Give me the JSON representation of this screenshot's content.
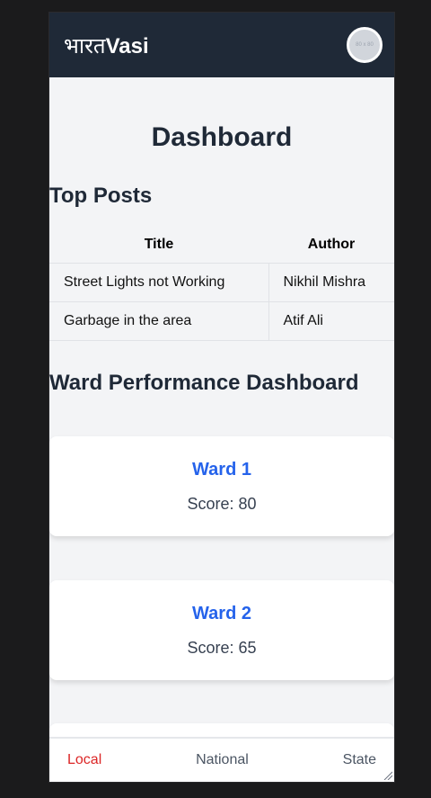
{
  "header": {
    "brand_prefix": "भारत",
    "brand_suffix": "Vasi",
    "avatar_text": "80 x 80"
  },
  "page_title": "Dashboard",
  "top_posts": {
    "heading": "Top Posts",
    "columns": [
      "Title",
      "Author"
    ],
    "rows": [
      {
        "title": "Street Lights not Working",
        "author": "Nikhil Mishra"
      },
      {
        "title": "Garbage in the area",
        "author": "Atif Ali"
      }
    ]
  },
  "ward_dashboard": {
    "heading": "Ward Performance Dashboard",
    "wards": [
      {
        "name": "Ward 1",
        "score": "Score: 80"
      },
      {
        "name": "Ward 2",
        "score": "Score: 65"
      }
    ]
  },
  "bottom_nav": {
    "items": [
      "Local",
      "National",
      "State"
    ],
    "active": "Local"
  },
  "colors": {
    "header_bg": "#1f2937",
    "accent_blue": "#2563eb",
    "active_red": "#dc2626"
  }
}
